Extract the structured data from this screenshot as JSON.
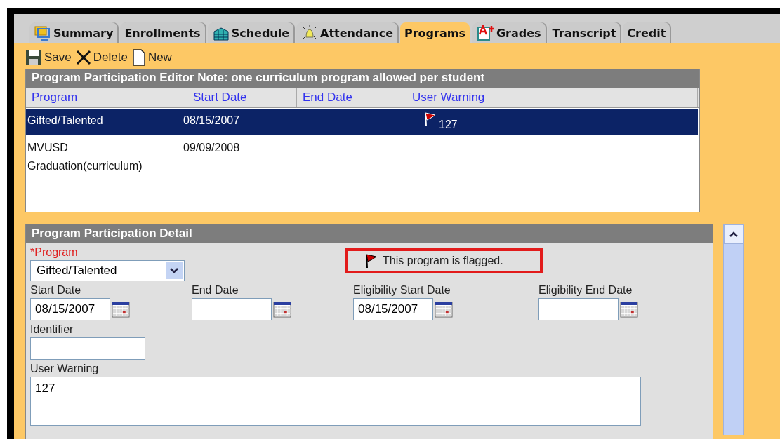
{
  "tabs": [
    {
      "label": "Summary",
      "selected": false
    },
    {
      "label": "Enrollments",
      "selected": false
    },
    {
      "label": "Schedule",
      "selected": false
    },
    {
      "label": "Attendance",
      "selected": false
    },
    {
      "label": "Programs",
      "selected": true
    },
    {
      "label": "Grades",
      "selected": false
    },
    {
      "label": "Transcript",
      "selected": false
    },
    {
      "label": "Credit",
      "selected": false
    }
  ],
  "toolbar": [
    "Save",
    "Delete",
    "New"
  ],
  "list": {
    "title": "Program Participation Editor Note: one curriculum program allowed per student",
    "columns": [
      "Program",
      "Start Date",
      "End Date",
      "User Warning"
    ],
    "rows": [
      {
        "program": "Gifted/Talented",
        "start_date": "08/15/2007",
        "user_warning": "127",
        "flagged": true,
        "selected": true
      },
      {
        "program": "MVUSD Graduation(curriculum)",
        "start_date": "09/09/2008",
        "flagged": false,
        "selected": false
      }
    ]
  },
  "detail": {
    "title": "Program Participation Detail",
    "program": {
      "label": "*Program",
      "value": "Gifted/Talented"
    },
    "flag_message": "This program is flagged.",
    "dates": [
      {
        "label": "Start Date",
        "value": "08/15/2007"
      },
      {
        "label": "End Date"
      },
      {
        "label": "Eligibility Start Date",
        "value": "08/15/2007"
      },
      {
        "label": "Eligibility End Date"
      }
    ],
    "identifier": {
      "label": "Identifier"
    },
    "user_warning": {
      "label": "User Warning",
      "value": "127"
    }
  }
}
